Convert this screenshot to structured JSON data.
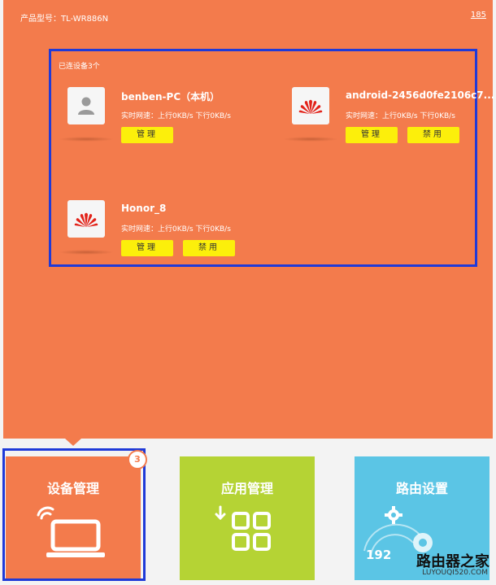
{
  "header": {
    "product_model": "产品型号：TL-WR886N",
    "top_right_link": "185"
  },
  "device_panel": {
    "connected_count": "已连设备3个",
    "devices": [
      {
        "icon": "person-icon",
        "name": "benben-PC（本机）",
        "speed": "实时网速：上行0KB/s  下行0KB/s",
        "manage_label": "管理"
      },
      {
        "icon": "huawei-logo-icon",
        "name": "android-2456d0fe2106c7...",
        "speed": "实时网速：上行0KB/s  下行0KB/s",
        "manage_label": "管理",
        "block_label": "禁用"
      },
      {
        "icon": "huawei-logo-icon",
        "name": "Honor_8",
        "speed": "实时网速：上行0KB/s  下行0KB/s",
        "manage_label": "管理",
        "block_label": "禁用"
      }
    ]
  },
  "nav_tiles": [
    {
      "label": "设备管理",
      "icon": "laptop-wifi-icon",
      "badge": "3",
      "color": "#f37b4c"
    },
    {
      "label": "应用管理",
      "icon": "app-grid-icon",
      "color": "#b5d334"
    },
    {
      "label": "路由设置",
      "icon": "gear-icon",
      "sub_text": "192",
      "color": "#5bc5e5"
    }
  ],
  "watermark": {
    "text": "路由器之家",
    "url": "LUYOUQI520.COM"
  }
}
